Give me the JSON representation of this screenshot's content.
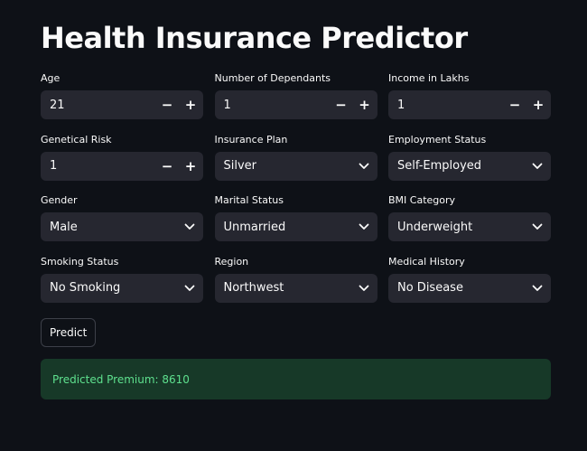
{
  "page": {
    "title": "Health Insurance Predictor"
  },
  "fields": {
    "age": {
      "label": "Age",
      "value": "21"
    },
    "dependants": {
      "label": "Number of Dependants",
      "value": "1"
    },
    "income": {
      "label": "Income in Lakhs",
      "value": "1"
    },
    "genetical_risk": {
      "label": "Genetical Risk",
      "value": "1"
    },
    "insurance_plan": {
      "label": "Insurance Plan",
      "value": "Silver"
    },
    "employment_status": {
      "label": "Employment Status",
      "value": "Self-Employed"
    },
    "gender": {
      "label": "Gender",
      "value": "Male"
    },
    "marital_status": {
      "label": "Marital Status",
      "value": "Unmarried"
    },
    "bmi_category": {
      "label": "BMI Category",
      "value": "Underweight"
    },
    "smoking_status": {
      "label": "Smoking Status",
      "value": "No Smoking"
    },
    "region": {
      "label": "Region",
      "value": "Northwest"
    },
    "medical_history": {
      "label": "Medical History",
      "value": "No Disease"
    }
  },
  "stepper": {
    "minus": "−",
    "plus": "+"
  },
  "actions": {
    "predict_label": "Predict"
  },
  "result": {
    "text": "Predicted Premium: 8610"
  },
  "colors": {
    "background": "#0e1117",
    "input_bg": "#262730",
    "success_bg": "#173928",
    "success_text": "#5ee08e"
  },
  "icons": {
    "select_indicator": "chevron-down-icon"
  }
}
